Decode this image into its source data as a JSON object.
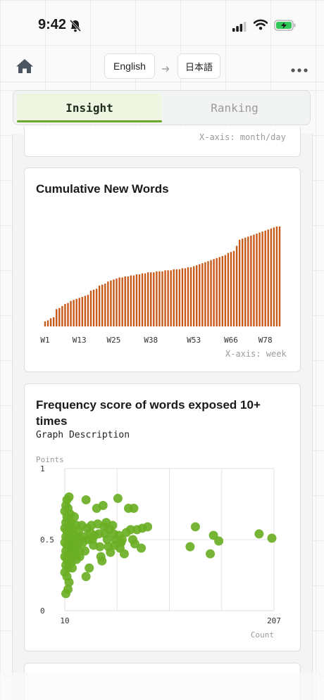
{
  "status_bar": {
    "time": "9:42"
  },
  "nav": {
    "from_language": "English",
    "to_language": "日本語"
  },
  "tabs": [
    {
      "label": "Insight",
      "active": true
    },
    {
      "label": "Ranking",
      "active": false
    }
  ],
  "previous_card": {
    "axis_note": "X-axis: month/day"
  },
  "cumulative_card": {
    "title": "Cumulative New Words",
    "axis_note": "X-axis: week"
  },
  "frequency_card": {
    "title_line1": "Frequency score of words exposed 10+",
    "title_line2": "times",
    "description": "Graph Description",
    "y_axis_label": "Points",
    "x_axis_label": "Count"
  },
  "colors": {
    "accent_green": "#6aa82b",
    "bar_orange": "#c85a1a",
    "point_green": "#6aaf24"
  },
  "chart_data": [
    {
      "type": "bar",
      "title": "Cumulative New Words",
      "xlabel": "X-axis: week",
      "tick_labels": [
        "W1",
        "W13",
        "W25",
        "W38",
        "W53",
        "W66",
        "W78"
      ],
      "tick_weeks": [
        1,
        13,
        25,
        38,
        53,
        66,
        78
      ],
      "weeks": [
        1,
        2,
        3,
        4,
        5,
        6,
        7,
        8,
        9,
        10,
        11,
        12,
        13,
        14,
        15,
        16,
        17,
        18,
        19,
        20,
        21,
        22,
        23,
        24,
        25,
        26,
        27,
        28,
        29,
        30,
        31,
        32,
        33,
        34,
        35,
        36,
        37,
        38,
        39,
        40,
        41,
        42,
        43,
        44,
        45,
        46,
        47,
        48,
        49,
        50,
        51,
        52,
        53,
        54,
        55,
        56,
        57,
        58,
        59,
        60,
        61,
        62,
        63,
        64,
        65,
        66,
        67,
        68,
        69,
        70,
        71,
        72,
        73,
        74,
        75,
        76,
        77,
        78,
        79,
        80,
        81,
        82,
        83
      ],
      "values": [
        5,
        6,
        8,
        9,
        17,
        18,
        20,
        22,
        23,
        25,
        26,
        27,
        28,
        29,
        30,
        31,
        35,
        36,
        37,
        40,
        41,
        42,
        44,
        45,
        46,
        47,
        48,
        48,
        49,
        49,
        50,
        50,
        51,
        51,
        52,
        52,
        53,
        53,
        53,
        54,
        54,
        54,
        55,
        55,
        55,
        56,
        56,
        56,
        57,
        57,
        58,
        58,
        59,
        60,
        61,
        62,
        63,
        64,
        65,
        66,
        67,
        68,
        69,
        70,
        72,
        73,
        74,
        79,
        85,
        86,
        87,
        88,
        89,
        90,
        91,
        92,
        93,
        94,
        95,
        96,
        97,
        98,
        98
      ],
      "ylim": [
        0,
        100
      ],
      "grid": false
    },
    {
      "type": "scatter",
      "title": "Frequency score of words exposed 10+ times",
      "xlabel": "Count",
      "ylabel": "Points",
      "xlim": [
        10,
        207
      ],
      "ylim": [
        0,
        1
      ],
      "x_ticks": [
        10,
        207
      ],
      "y_ticks": [
        0,
        0.5,
        1
      ],
      "grid": true,
      "points": [
        [
          12,
          0.78
        ],
        [
          11,
          0.74
        ],
        [
          13,
          0.72
        ],
        [
          14,
          0.8
        ],
        [
          10,
          0.7
        ],
        [
          12,
          0.66
        ],
        [
          11,
          0.62
        ],
        [
          13,
          0.64
        ],
        [
          15,
          0.6
        ],
        [
          10,
          0.58
        ],
        [
          12,
          0.56
        ],
        [
          14,
          0.55
        ],
        [
          11,
          0.52
        ],
        [
          13,
          0.5
        ],
        [
          10,
          0.48
        ],
        [
          12,
          0.46
        ],
        [
          15,
          0.44
        ],
        [
          11,
          0.42
        ],
        [
          13,
          0.4
        ],
        [
          10,
          0.38
        ],
        [
          12,
          0.36
        ],
        [
          14,
          0.34
        ],
        [
          11,
          0.32
        ],
        [
          13,
          0.3
        ],
        [
          10,
          0.27
        ],
        [
          12,
          0.24
        ],
        [
          14,
          0.2
        ],
        [
          11,
          0.12
        ],
        [
          13,
          0.15
        ],
        [
          16,
          0.5
        ],
        [
          15,
          0.68
        ],
        [
          16,
          0.62
        ],
        [
          17,
          0.58
        ],
        [
          18,
          0.54
        ],
        [
          16,
          0.46
        ],
        [
          17,
          0.42
        ],
        [
          18,
          0.38
        ],
        [
          16,
          0.34
        ],
        [
          17,
          0.3
        ],
        [
          19,
          0.52
        ],
        [
          18,
          0.48
        ],
        [
          20,
          0.44
        ],
        [
          21,
          0.6
        ],
        [
          19,
          0.66
        ],
        [
          20,
          0.4
        ],
        [
          21,
          0.36
        ],
        [
          22,
          0.52
        ],
        [
          23,
          0.56
        ],
        [
          22,
          0.46
        ],
        [
          24,
          0.42
        ],
        [
          25,
          0.5
        ],
        [
          26,
          0.6
        ],
        [
          24,
          0.38
        ],
        [
          27,
          0.48
        ],
        [
          28,
          0.52
        ],
        [
          30,
          0.78
        ],
        [
          29,
          0.42
        ],
        [
          31,
          0.58
        ],
        [
          32,
          0.5
        ],
        [
          33,
          0.3
        ],
        [
          30,
          0.24
        ],
        [
          34,
          0.55
        ],
        [
          35,
          0.6
        ],
        [
          36,
          0.5
        ],
        [
          37,
          0.46
        ],
        [
          38,
          0.53
        ],
        [
          40,
          0.72
        ],
        [
          41,
          0.61
        ],
        [
          42,
          0.54
        ],
        [
          43,
          0.45
        ],
        [
          44,
          0.38
        ],
        [
          45,
          0.35
        ],
        [
          46,
          0.74
        ],
        [
          47,
          0.59
        ],
        [
          48,
          0.54
        ],
        [
          49,
          0.62
        ],
        [
          50,
          0.5
        ],
        [
          51,
          0.45
        ],
        [
          52,
          0.57
        ],
        [
          53,
          0.41
        ],
        [
          55,
          0.6
        ],
        [
          56,
          0.54
        ],
        [
          57,
          0.46
        ],
        [
          58,
          0.5
        ],
        [
          60,
          0.79
        ],
        [
          61,
          0.53
        ],
        [
          62,
          0.44
        ],
        [
          63,
          0.48
        ],
        [
          64,
          0.5
        ],
        [
          66,
          0.4
        ],
        [
          68,
          0.55
        ],
        [
          70,
          0.72
        ],
        [
          72,
          0.57
        ],
        [
          74,
          0.5
        ],
        [
          75,
          0.72
        ],
        [
          76,
          0.47
        ],
        [
          78,
          0.57
        ],
        [
          82,
          0.44
        ],
        [
          83,
          0.58
        ],
        [
          88,
          0.59
        ],
        [
          128,
          0.45
        ],
        [
          133,
          0.59
        ],
        [
          147,
          0.4
        ],
        [
          150,
          0.53
        ],
        [
          155,
          0.49
        ],
        [
          193,
          0.54
        ],
        [
          205,
          0.51
        ]
      ]
    }
  ]
}
